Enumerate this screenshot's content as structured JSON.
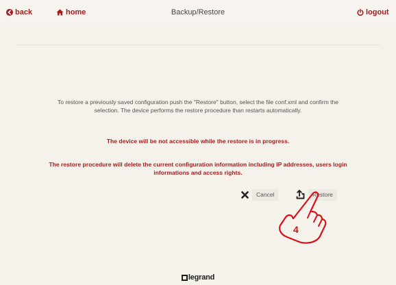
{
  "header": {
    "back_label": "back",
    "home_label": "home",
    "title": "Backup/Restore",
    "logout_label": "logout"
  },
  "content": {
    "instructions": "To restore a previously saved configuration push the \"Restore\" button, select the file conf.xml and confirm the selection. The device performs the restore procedure than restarts automatically.",
    "warning_access": "The device will be not accessible while the restore is in progress.",
    "warning_delete": "The restore procedure will delete the current configuration information including IP addresses, users login informations and access rights."
  },
  "actions": {
    "cancel_label": "Cancel",
    "restore_label": "Restore"
  },
  "annotation": {
    "step_number": "4"
  },
  "footer": {
    "brand": "legrand"
  },
  "icons": {
    "back": "back-arrow-circle-icon",
    "home": "home-icon",
    "logout": "power-icon",
    "cancel": "x-icon",
    "restore": "upload-icon",
    "pointer": "pointing-hand-icon"
  },
  "colors": {
    "accent": "#a41d1d",
    "background": "#f5f1eb",
    "annotation_hand": "#d9101a"
  }
}
